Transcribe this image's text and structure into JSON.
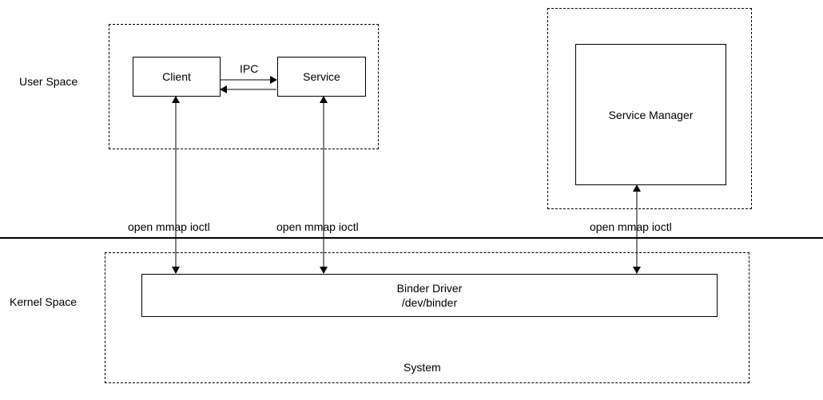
{
  "labels": {
    "user_space": "User Space",
    "kernel_space": "Kernel Space",
    "system": "System"
  },
  "boxes": {
    "client": "Client",
    "service": "Service",
    "service_manager": "Service Manager",
    "binder_driver_title": "Binder Driver",
    "binder_driver_path": "/dev/binder"
  },
  "connectors": {
    "ipc": "IPC",
    "syscalls_client": "open  mmap  ioctl",
    "syscalls_service": "open  mmap  ioctl",
    "syscalls_mgr": "open  mmap  ioctl"
  }
}
